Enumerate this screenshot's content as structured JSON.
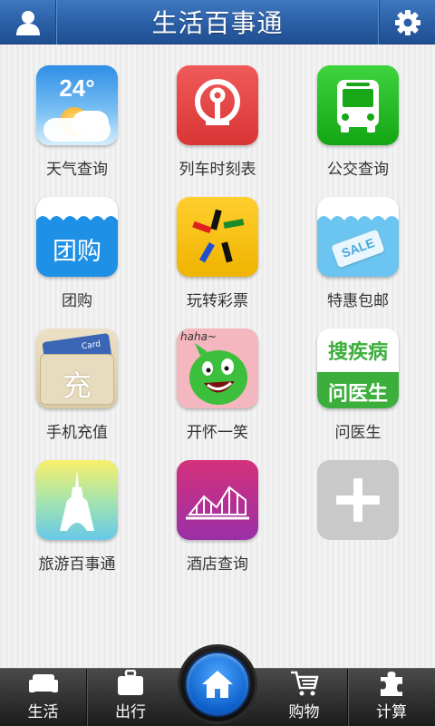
{
  "header": {
    "title": "生活百事通",
    "user_icon": "user-icon",
    "settings_icon": "gear-icon"
  },
  "grid": {
    "items": [
      {
        "label": "天气查询",
        "icon": "weather-icon",
        "tile_text": "24°"
      },
      {
        "label": "列车时刻表",
        "icon": "train-logo-icon"
      },
      {
        "label": "公交查询",
        "icon": "bus-icon"
      },
      {
        "label": "团购",
        "icon": "group-buy-icon",
        "tile_text": "团购"
      },
      {
        "label": "玩转彩票",
        "icon": "lottery-icon"
      },
      {
        "label": "特惠包邮",
        "icon": "sale-tag-icon",
        "tile_text": "SALE"
      },
      {
        "label": "手机充值",
        "icon": "recharge-card-icon",
        "tile_text": "充",
        "card_text": "Card"
      },
      {
        "label": "开怀一笑",
        "icon": "laughing-face-icon",
        "tile_text": "haha~"
      },
      {
        "label": "问医生",
        "icon": "doctor-icon",
        "tile_text_1": "搜疾病",
        "tile_text_2": "问医生"
      },
      {
        "label": "旅游百事通",
        "icon": "eiffel-tower-icon"
      },
      {
        "label": "酒店查询",
        "icon": "hotel-building-icon"
      },
      {
        "label": "",
        "icon": "add-icon"
      }
    ]
  },
  "bottombar": {
    "tabs": [
      {
        "label": "生活",
        "icon": "sofa-icon"
      },
      {
        "label": "出行",
        "icon": "suitcase-icon"
      },
      {
        "label": "购物",
        "icon": "cart-icon"
      },
      {
        "label": "计算",
        "icon": "puzzle-icon"
      }
    ],
    "home_icon": "home-icon"
  }
}
